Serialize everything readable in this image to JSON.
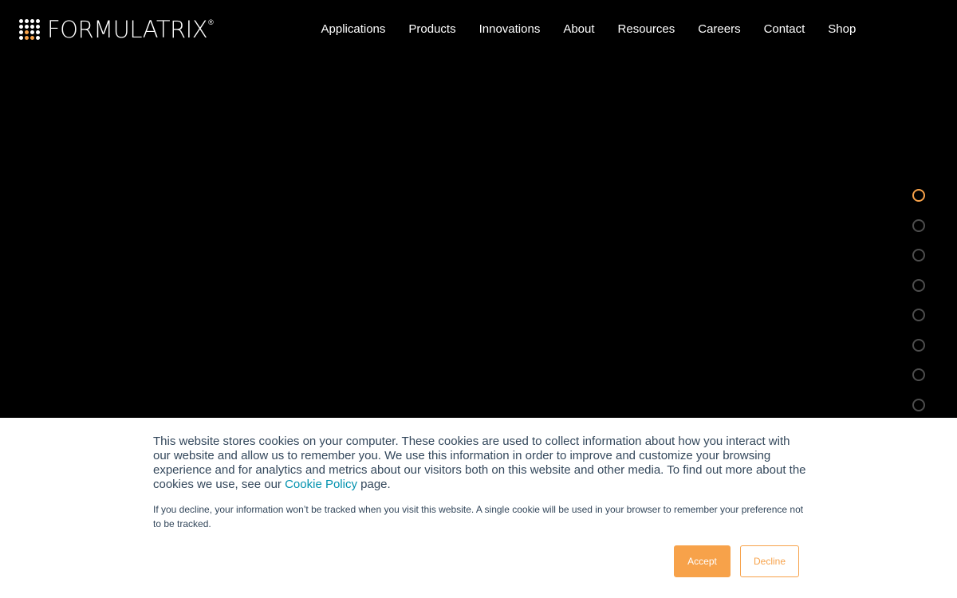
{
  "brand": {
    "name": "FORMULATRIX",
    "registered_mark": "®",
    "logo_icon": "dot-grid-logo-icon",
    "accent_color": "#f7a24a"
  },
  "nav": {
    "items": [
      {
        "label": "Applications"
      },
      {
        "label": "Products"
      },
      {
        "label": "Innovations"
      },
      {
        "label": "About"
      },
      {
        "label": "Resources"
      },
      {
        "label": "Careers"
      },
      {
        "label": "Contact"
      },
      {
        "label": "Shop"
      }
    ]
  },
  "hero": {
    "background_color": "#000000",
    "slide_count": 8,
    "active_slide": 1
  },
  "cookie_banner": {
    "text_before_link": "This website stores cookies on your computer. These cookies are used to collect information about how you interact with our website and allow us to remember you. We use this information in order to improve and customize your browsing experience and for analytics and metrics about our visitors both on this website and other media. To find out more about the cookies we use, see our ",
    "link_label": "Cookie Policy",
    "text_after_link": " page.",
    "secondary_text": "If you decline, your information won’t be tracked when you visit this website. A single cookie will be used in your browser to remember your preference not to be tracked.",
    "accept_label": "Accept",
    "decline_label": "Decline",
    "link_color": "#0091ae",
    "text_color": "#33475b"
  }
}
